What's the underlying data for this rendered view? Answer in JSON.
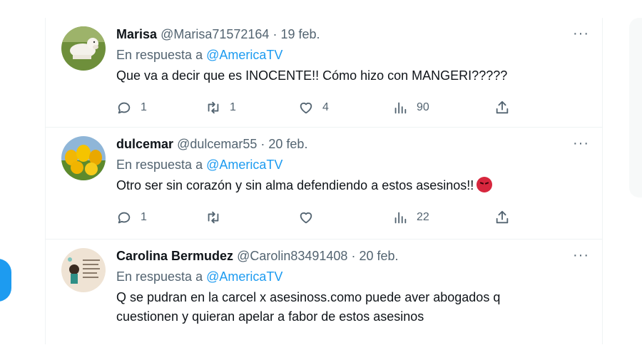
{
  "tweets": [
    {
      "name": "Marisa",
      "handle": "@Marisa71572164",
      "date": "· 19 feb.",
      "reply_prefix": "En respuesta a",
      "reply_mention": "@AmericaTV",
      "text": "Que va a decir que es INOCENTE!! Cómo hizo con MANGERI?????",
      "replies": "1",
      "retweets": "1",
      "likes": "4",
      "views": "90"
    },
    {
      "name": "dulcemar",
      "handle": "@dulcemar55",
      "date": "· 20 feb.",
      "reply_prefix": "En respuesta a",
      "reply_mention": "@AmericaTV",
      "text": "Otro ser sin corazón y sin alma defendiendo a estos asesinos!!",
      "replies": "1",
      "retweets": "",
      "likes": "",
      "views": "22"
    },
    {
      "name": "Carolina Bermudez",
      "handle": "@Carolin83491408",
      "date": "· 20 feb.",
      "reply_prefix": "En respuesta a",
      "reply_mention": "@AmericaTV",
      "text_line1": "Q se pudran en la carcel x asesinoss.como puede aver abogados q",
      "text_line2": "cuestionen y quieran apelar a fabor de estos asesinos"
    }
  ],
  "more_glyph": "···",
  "colors": {
    "accent": "#1d9bf0",
    "muted": "#536471",
    "text": "#0f1419"
  },
  "icons": [
    "reply-icon",
    "retweet-icon",
    "like-icon",
    "views-icon",
    "share-icon",
    "more-icon",
    "angry-face-emoji"
  ]
}
